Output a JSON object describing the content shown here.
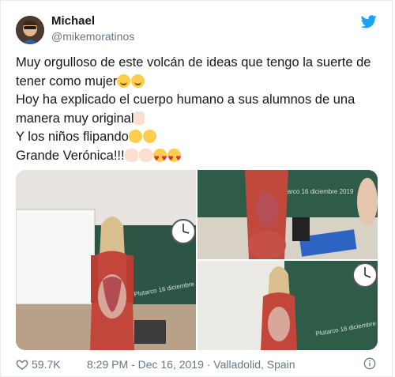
{
  "author": {
    "name": "Michael",
    "handle": "@mikemoratinos"
  },
  "tweet": {
    "lines": [
      "Muy orgulloso de este volcán de ideas que tengo la suerte de",
      "tener como mujer",
      "Hoy ha explicado el cuerpo humano a sus alumnos de una",
      "manera muy original",
      "Y los niños flipando",
      "Grande Verónica!!!"
    ]
  },
  "footer": {
    "likes": "59.7K",
    "meta": "8:29 PM - Dec 16, 2019 · Valladolid, Spain"
  },
  "icons": {
    "brand": "twitter-bird-icon",
    "like": "heart-icon",
    "info": "info-icon"
  },
  "colors": {
    "twitter_blue": "#1da1f2",
    "text": "#14171a",
    "secondary": "#657786",
    "chalkboard": "#2f5b49"
  }
}
